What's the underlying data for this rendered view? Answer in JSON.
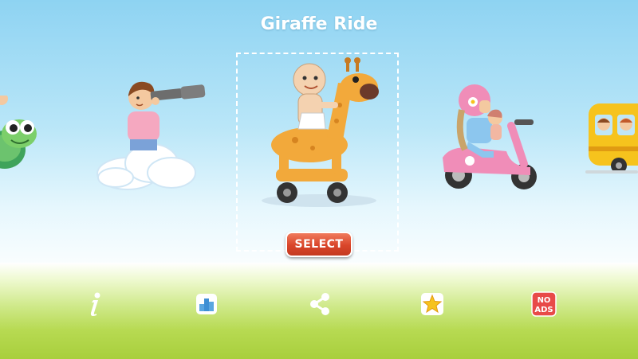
{
  "title": "Giraffe Ride",
  "select_label": "SELECT",
  "noads": {
    "line1": "NO",
    "line2": "ADS"
  },
  "carousel": [
    "turtle-ride",
    "telescope-on-cloud",
    "giraffe-ride",
    "scooter-ride",
    "school-bus-ride"
  ],
  "bottom_bar": [
    "info-icon",
    "leaderboard-icon",
    "share-icon",
    "star-rate-icon",
    "no-ads-icon"
  ],
  "colors": {
    "select_button": "#d9452a",
    "giraffe": "#f2a93b",
    "scooter": "#f08db8",
    "bus": "#f6c31d"
  }
}
